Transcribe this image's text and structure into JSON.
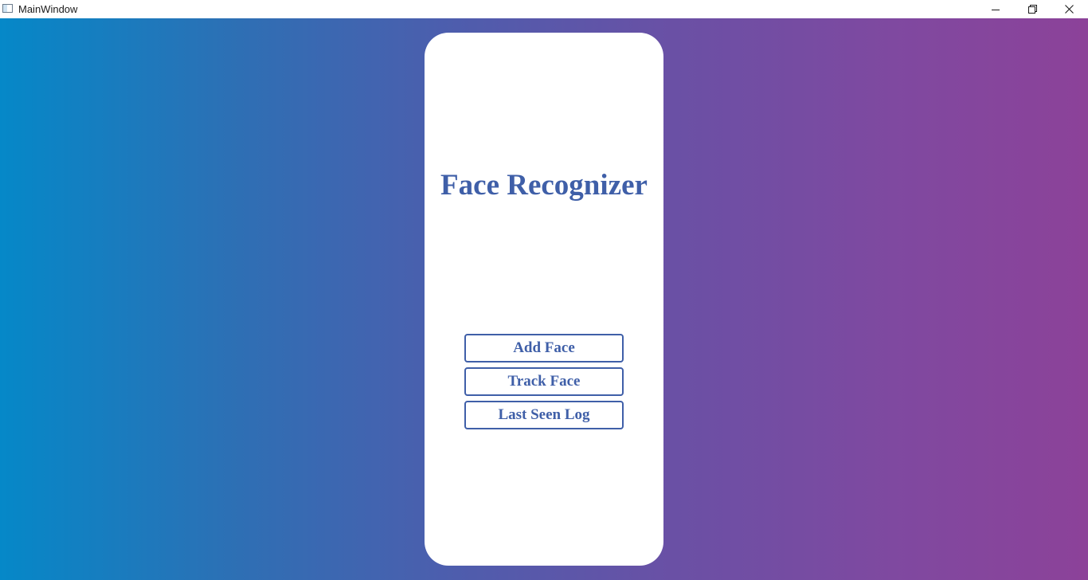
{
  "window": {
    "title": "MainWindow",
    "controls": {
      "minimize_icon": "minimize-icon",
      "maximize_icon": "restore-icon",
      "close_icon": "close-icon"
    }
  },
  "main": {
    "title": "Face Recognizer",
    "buttons": [
      {
        "label": "Add Face"
      },
      {
        "label": "Track Face"
      },
      {
        "label": "Last Seen Log"
      }
    ]
  },
  "colors": {
    "gradient_start": "#0588c8",
    "gradient_end": "#8c4299",
    "accent": "#3f5fa8",
    "card": "#ffffff"
  }
}
